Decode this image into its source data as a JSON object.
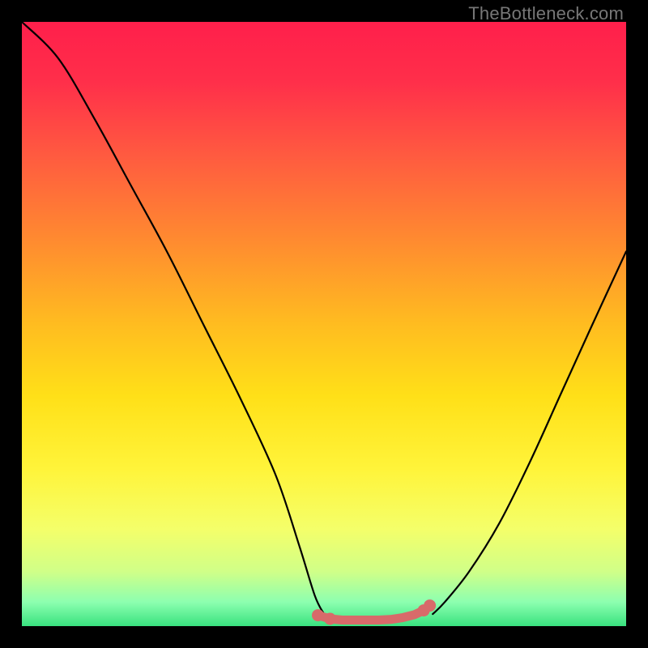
{
  "watermark": "TheBottleneck.com",
  "gradient_stops": [
    {
      "offset": 0.0,
      "color": "#ff1f4b"
    },
    {
      "offset": 0.1,
      "color": "#ff2f4a"
    },
    {
      "offset": 0.22,
      "color": "#ff5a40"
    },
    {
      "offset": 0.36,
      "color": "#ff8a30"
    },
    {
      "offset": 0.5,
      "color": "#ffbc20"
    },
    {
      "offset": 0.62,
      "color": "#ffe018"
    },
    {
      "offset": 0.74,
      "color": "#fff43a"
    },
    {
      "offset": 0.84,
      "color": "#f4ff6a"
    },
    {
      "offset": 0.91,
      "color": "#d0ff88"
    },
    {
      "offset": 0.96,
      "color": "#8dffb0"
    },
    {
      "offset": 1.0,
      "color": "#39e27f"
    }
  ],
  "chart_data": {
    "type": "line",
    "title": "",
    "xlabel": "",
    "ylabel": "",
    "xlim": [
      0,
      100
    ],
    "ylim": [
      0,
      100
    ],
    "grid": false,
    "series": [
      {
        "name": "bottleneck-curve-left",
        "color": "#000000",
        "x": [
          0,
          6,
          12,
          18,
          24,
          30,
          36,
          42,
          46,
          48.5,
          50
        ],
        "values": [
          100,
          94,
          84,
          73,
          62,
          50,
          38,
          25,
          13,
          5,
          2
        ]
      },
      {
        "name": "bottleneck-curve-right",
        "color": "#000000",
        "x": [
          68,
          70,
          74,
          79,
          84,
          89,
          94,
          100
        ],
        "values": [
          2,
          4,
          9,
          17,
          27,
          38,
          49,
          62
        ]
      },
      {
        "name": "bottleneck-flat-dots",
        "color": "#d86a6a",
        "x": [
          49,
          51,
          53,
          55,
          57,
          59,
          61,
          63,
          65,
          66.5,
          67.5
        ],
        "values": [
          1.8,
          1.2,
          1.0,
          1.0,
          1.0,
          1.0,
          1.1,
          1.4,
          1.9,
          2.6,
          3.4
        ]
      }
    ],
    "legend": false
  }
}
